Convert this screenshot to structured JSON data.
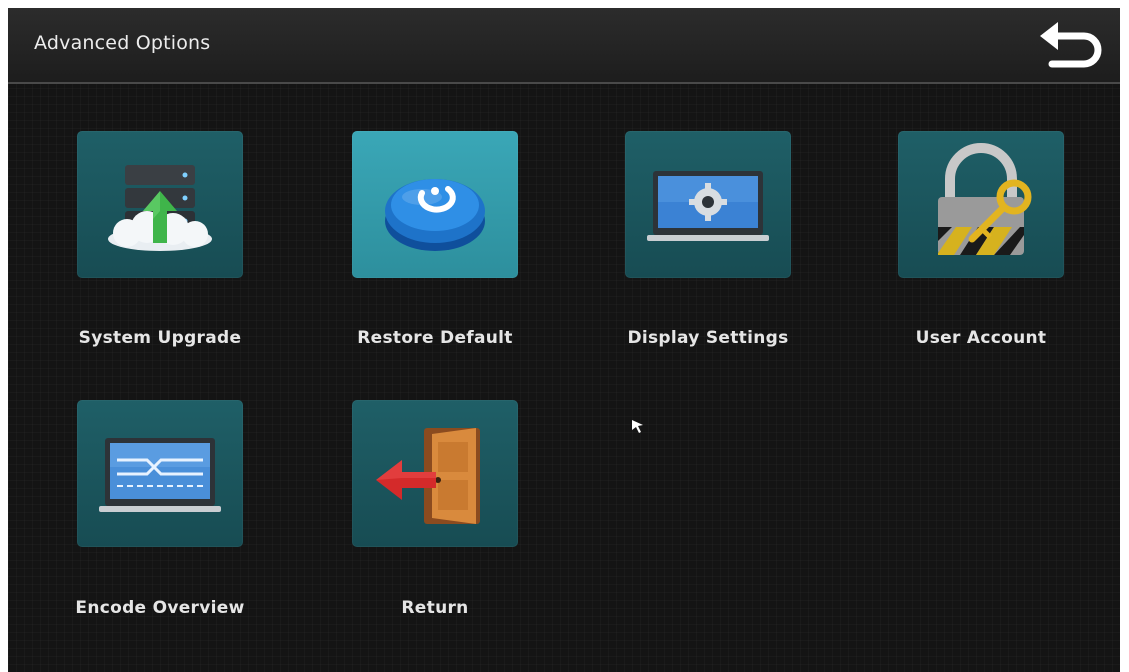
{
  "header": {
    "title": "Advanced Options",
    "back_icon": "return-arrow-icon"
  },
  "menu": {
    "items": [
      {
        "label": "System Upgrade",
        "icon": "server-upload-icon"
      },
      {
        "label": "Restore Default",
        "icon": "restore-button-icon",
        "selected": true
      },
      {
        "label": "Display Settings",
        "icon": "monitor-settings-icon"
      },
      {
        "label": "User Account",
        "icon": "lock-key-icon"
      },
      {
        "label": "Encode Overview",
        "icon": "encode-panel-icon"
      },
      {
        "label": "Return",
        "icon": "exit-door-icon"
      }
    ]
  },
  "colors": {
    "background": "#141414",
    "tile": "#1f5f67",
    "tile_selected": "#3aa7b7",
    "text": "#e6e6e6"
  }
}
